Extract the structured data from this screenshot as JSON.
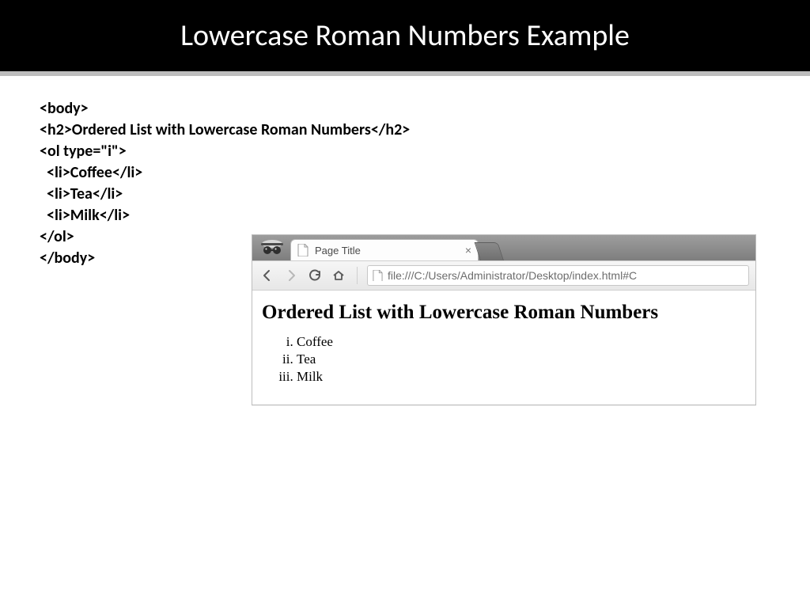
{
  "title": "Lowercase Roman Numbers Example",
  "code_block": "<body>\n<h2>Ordered List with Lowercase Roman Numbers</h2>\n<ol type=\"i\">\n  <li>Coffee</li>\n  <li>Tea</li>\n  <li>Milk</li>\n</ol>\n</body>",
  "browser": {
    "tab_title": "Page Title",
    "url": "file:///C:/Users/Administrator/Desktop/index.html#C"
  },
  "rendered": {
    "heading": "Ordered List with Lowercase Roman Numbers",
    "items": [
      "Coffee",
      "Tea",
      "Milk"
    ],
    "list_type": "i"
  }
}
